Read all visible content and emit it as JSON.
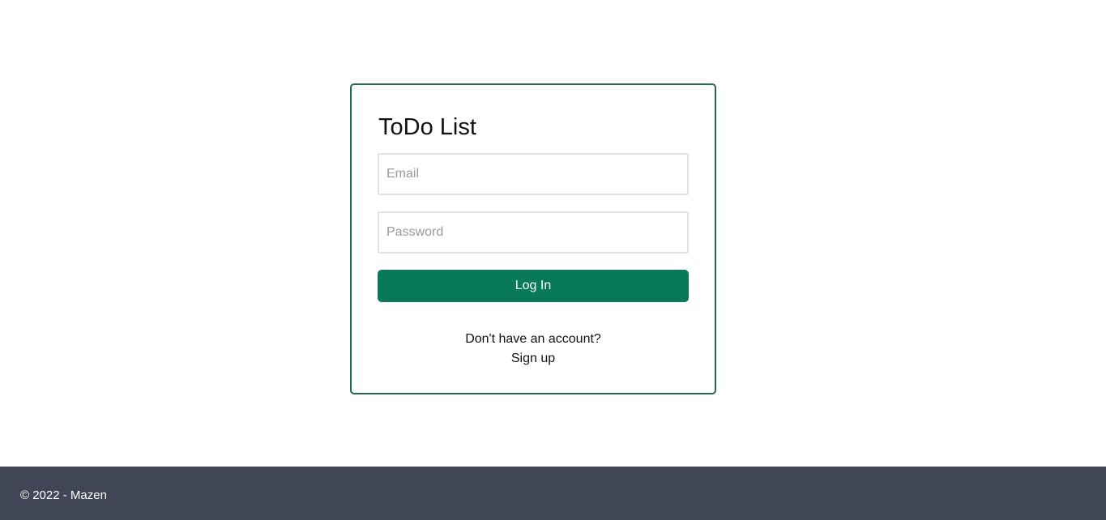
{
  "app": {
    "title": "ToDo List"
  },
  "login_form": {
    "email_placeholder": "Email",
    "email_value": "",
    "password_placeholder": "Password",
    "password_value": "",
    "submit_label": "Log In"
  },
  "signup": {
    "prompt": "Don't have an account?",
    "link_label": "Sign up"
  },
  "footer": {
    "text": "© 2022 - Mazen"
  },
  "colors": {
    "accent": "#087a5a",
    "card_border": "#1f6a55",
    "footer_background": "#414656"
  }
}
